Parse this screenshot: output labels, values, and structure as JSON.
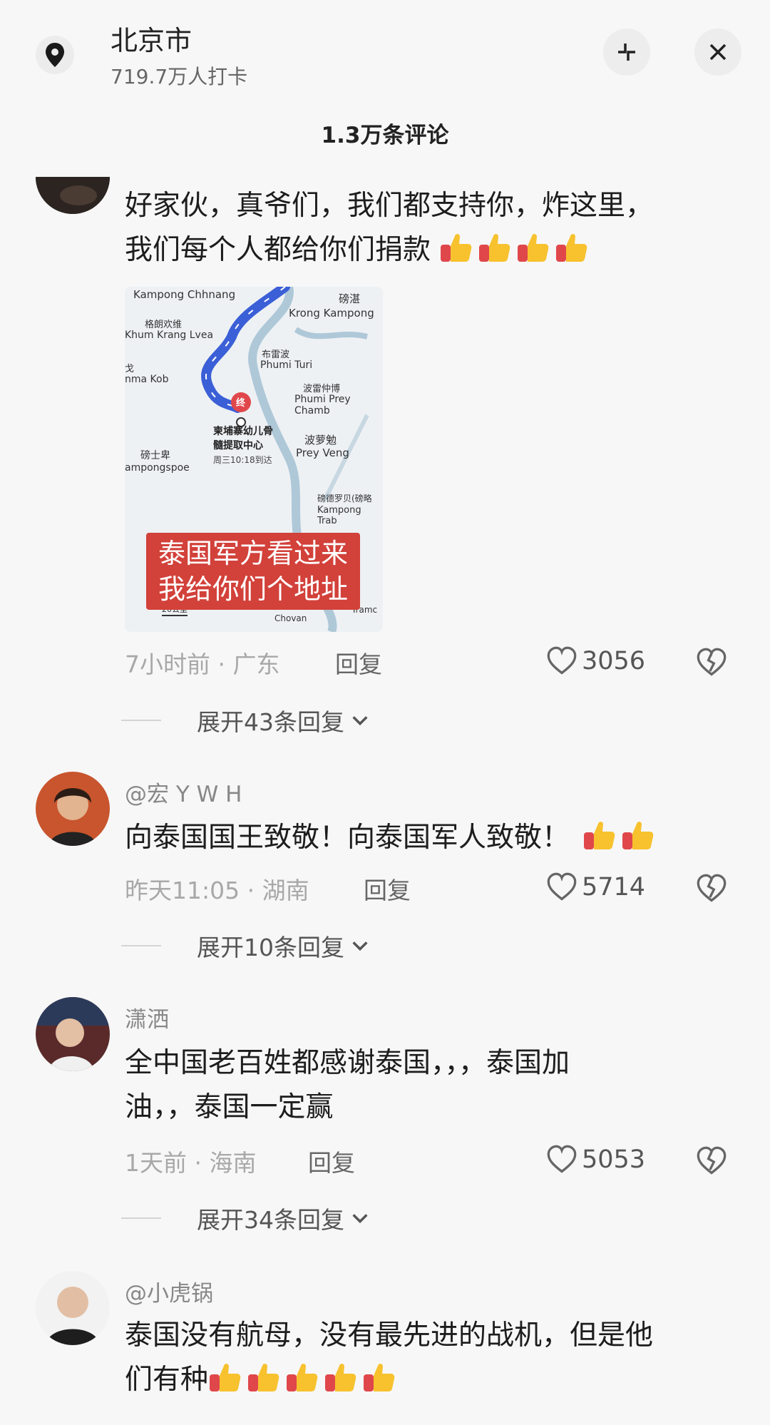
{
  "header": {
    "location": "北京市",
    "checkins": "719.7万人打卡",
    "comment_count": "1.3万条评论"
  },
  "comments": [
    {
      "username": "",
      "text_line1": "好家伙，真爷们，我们都支持你，炸这里，",
      "text_line2": "我们每个人都给你们捐款",
      "emoji_count": 4,
      "time": "7小时前",
      "region": "广东",
      "reply_label": "回复",
      "likes": "3056",
      "expand": "展开43条回复",
      "image": {
        "map_labels": {
          "kampong_chhnang": "Kampong Chhnang",
          "pangzhan": "磅湛",
          "krong_kampong": "Krong Kampong",
          "gelang": "格朗欢维",
          "khum_krang": "Khum Krang Lvea",
          "bulei": "布雷波",
          "phumi_turi": "Phumi Turi",
          "ge": "戈",
          "nma_kob": "nma Kob",
          "boleizhong": "波雷仲博",
          "phumi_prey": "Phumi Prey Chamb",
          "dest_marker": "终",
          "dest_name1": "柬埔寨幼儿骨",
          "dest_name2": "髓提取中心",
          "dest_time": "周三10:18到达",
          "boluomian": "波萝勉",
          "prey_veng": "Prey Veng",
          "bangshibei": "磅士卑",
          "kampongspoe": "ampongspoe",
          "bangdeluobei": "磅德罗贝(磅略",
          "kampong_trab": "Kampong Trab",
          "chroan": "Chovan",
          "tramc": "Tramc",
          "scale": "20公里"
        },
        "caption_line1": "泰国军方看过来",
        "caption_line2": "我给你们个地址"
      }
    },
    {
      "username": "@宏 Y W H",
      "text_line1": "向泰国国王致敬！向泰国军人致敬！",
      "emoji_count": 2,
      "time": "昨天11:05",
      "region": "湖南",
      "reply_label": "回复",
      "likes": "5714",
      "expand": "展开10条回复"
    },
    {
      "username": "潇洒",
      "text_line1": "全中国老百姓都感谢泰国，，，泰国加",
      "text_line2": "油，，泰国一定赢",
      "time": "1天前",
      "region": "海南",
      "reply_label": "回复",
      "likes": "5053",
      "expand": "展开34条回复"
    },
    {
      "username": "@小虎锅",
      "text_line1": "泰国没有航母，没有最先进的战机，但是他",
      "text_line2": "们有种",
      "emoji_count": 5
    }
  ],
  "icons": {
    "pin": "location-pin-icon",
    "collapse": "collapse-icon",
    "close": "close-icon",
    "like": "heart-icon",
    "dislike": "broken-heart-icon",
    "chevron": "chevron-down-icon",
    "emoji": "thumbs-up-emoji"
  },
  "colors": {
    "caption_bg": "#d2413a",
    "route_blue": "#3b5fd6",
    "map_bg": "#eef1f4",
    "emoji_yellow": "#f7c22e",
    "emoji_red": "#e0474b"
  }
}
